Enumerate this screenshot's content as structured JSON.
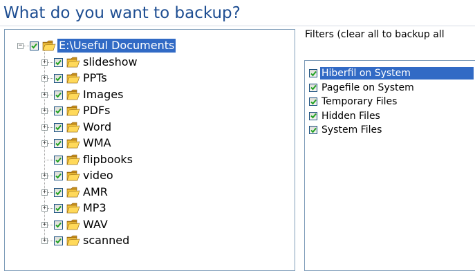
{
  "header": {
    "title": "What do you want to backup?"
  },
  "tree": {
    "root": {
      "label": "E:\\Useful Documents",
      "checked": true,
      "expanded": true,
      "icon": "folder-icon"
    },
    "children": [
      {
        "label": "slideshow",
        "checked": true,
        "expandable": true
      },
      {
        "label": "PPTs",
        "checked": true,
        "expandable": true
      },
      {
        "label": "Images",
        "checked": true,
        "expandable": true
      },
      {
        "label": "PDFs",
        "checked": true,
        "expandable": true
      },
      {
        "label": "Word",
        "checked": true,
        "expandable": true
      },
      {
        "label": "WMA",
        "checked": true,
        "expandable": true
      },
      {
        "label": "flipbooks",
        "checked": true,
        "expandable": false
      },
      {
        "label": "video",
        "checked": true,
        "expandable": true
      },
      {
        "label": "AMR",
        "checked": true,
        "expandable": true
      },
      {
        "label": "MP3",
        "checked": true,
        "expandable": true
      },
      {
        "label": "WAV",
        "checked": true,
        "expandable": true
      },
      {
        "label": "scanned",
        "checked": true,
        "expandable": true
      }
    ]
  },
  "filters": {
    "caption": "Filters (clear all to backup all",
    "items": [
      {
        "label": "Hiberfil on System",
        "checked": true,
        "selected": true
      },
      {
        "label": "Pagefile on System",
        "checked": true,
        "selected": false
      },
      {
        "label": "Temporary Files",
        "checked": true,
        "selected": false
      },
      {
        "label": "Hidden Files",
        "checked": true,
        "selected": false
      },
      {
        "label": "System Files",
        "checked": true,
        "selected": false
      }
    ]
  },
  "colors": {
    "title": "#1e4e92",
    "selection": "#316ac5",
    "folder": "#f2c23a",
    "check": "#21a121"
  }
}
